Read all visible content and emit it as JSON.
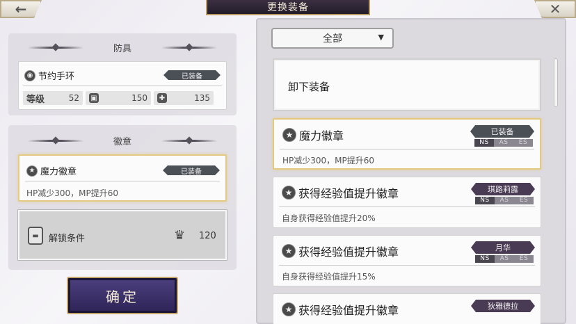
{
  "header": {
    "title": "更换装备",
    "back_icon": "←",
    "close_icon": "✕"
  },
  "armor_section": {
    "heading": "防具",
    "item": {
      "name": "节约手环",
      "icon": "bracelet-icon",
      "tag": "已装备",
      "stats": {
        "level_label": "等级",
        "level_value": "52",
        "defense_value": "150",
        "hp_value": "135"
      }
    }
  },
  "badge_section": {
    "heading": "徽章",
    "item": {
      "name": "魔力徽章",
      "tag": "已装备",
      "desc": "HP减少300，MP提升60"
    },
    "unlock": {
      "label": "解锁条件",
      "value": "120"
    }
  },
  "confirm_label": "确定",
  "filter": {
    "selected": "全部",
    "arrow": "▼"
  },
  "unequip_label": "卸下装备",
  "list_items": [
    {
      "name": "魔力徽章",
      "tag": "已装备",
      "tag_style": "gray",
      "desc": "HP减少300，MP提升60",
      "selected": true,
      "status": [
        "NS",
        "AS",
        "ES"
      ],
      "status_on": "NS"
    },
    {
      "name": "获得经验值提升徽章",
      "tag": "琪路莉露",
      "tag_style": "purple",
      "desc": "自身获得经验值提升20%",
      "selected": false,
      "status": [
        "NS",
        "AS",
        "ES"
      ],
      "status_on": "NS"
    },
    {
      "name": "获得经验值提升徽章",
      "tag": "月华",
      "tag_style": "purple",
      "desc": "自身获得经验值提升15%",
      "selected": false,
      "status": [
        "NS",
        "AS",
        "ES"
      ],
      "status_on": "NS"
    },
    {
      "name": "获得经验值提升徽章",
      "tag": "狄雅德拉",
      "tag_style": "purple",
      "desc": "",
      "selected": false,
      "status": [],
      "status_on": ""
    }
  ],
  "colors": {
    "accent_gold": "#e3c982",
    "tag_gray": "#4b4f56",
    "tag_purple": "#4a3b55",
    "confirm_bg": "#3a2f6a"
  }
}
